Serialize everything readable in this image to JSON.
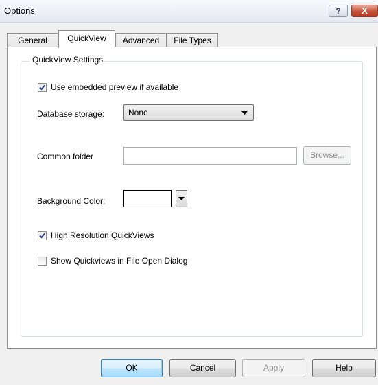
{
  "window": {
    "title": "Options",
    "help_glyph": "?",
    "close_glyph": "X"
  },
  "tabs": [
    {
      "label": "General",
      "active": false
    },
    {
      "label": "QuickView",
      "active": true
    },
    {
      "label": "Advanced",
      "active": false
    },
    {
      "label": "File Types",
      "active": false
    }
  ],
  "group": {
    "title": "QuickView Settings"
  },
  "settings": {
    "embedded_preview": {
      "label": "Use embedded preview if available",
      "checked": true
    },
    "database_storage": {
      "label": "Database storage:",
      "value": "None"
    },
    "common_folder": {
      "label": "Common folder",
      "value": "",
      "browse_label": "Browse..."
    },
    "background_color": {
      "label": "Background Color:",
      "value": "#ffffff"
    },
    "high_res": {
      "label": "High Resolution QuickViews",
      "checked": true
    },
    "file_open": {
      "label": "Show Quickviews in File Open Dialog",
      "checked": false
    }
  },
  "buttons": {
    "ok": "OK",
    "cancel": "Cancel",
    "apply": "Apply",
    "help": "Help"
  },
  "colors": {
    "check": "#1b3f8b",
    "default_button_border": "#3c7fb1"
  }
}
